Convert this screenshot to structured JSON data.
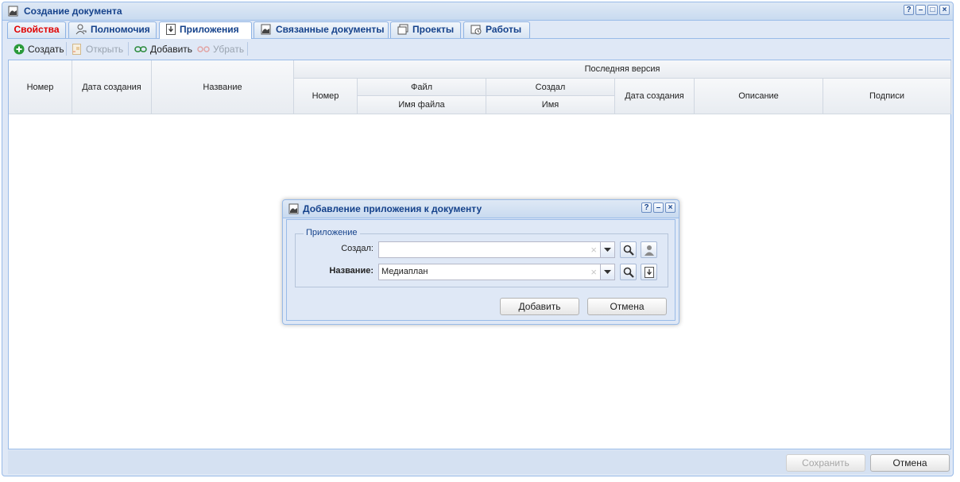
{
  "window": {
    "title": "Создание документа"
  },
  "tabs": [
    {
      "label": "Свойства"
    },
    {
      "label": "Полномочия"
    },
    {
      "label": "Приложения"
    },
    {
      "label": "Связанные документы"
    },
    {
      "label": "Проекты"
    },
    {
      "label": "Работы"
    }
  ],
  "toolbar": {
    "create": "Создать",
    "open": "Открыть",
    "add": "Добавить",
    "remove": "Убрать"
  },
  "grid": {
    "columns": {
      "number": "Номер",
      "created_date": "Дата создания",
      "name": "Название"
    },
    "group": "Последняя версия",
    "sub": {
      "number": "Номер",
      "file": "Файл",
      "file_name": "Имя файла",
      "creator": "Создал",
      "creator_name": "Имя",
      "created_date": "Дата создания",
      "description": "Описание",
      "signatures": "Подписи"
    }
  },
  "footer": {
    "save": "Сохранить",
    "cancel": "Отмена"
  },
  "dialog": {
    "title": "Добавление приложения к документу",
    "legend": "Приложение",
    "creator_label": "Создал:",
    "creator_value": "",
    "name_label": "Название:",
    "name_value": "Медиаплан",
    "add": "Добавить",
    "cancel": "Отмена"
  },
  "colors": {
    "accent": "#15428b",
    "border": "#99bbe8",
    "panel": "#dfe8f6",
    "tab_alert": "#e00000"
  }
}
